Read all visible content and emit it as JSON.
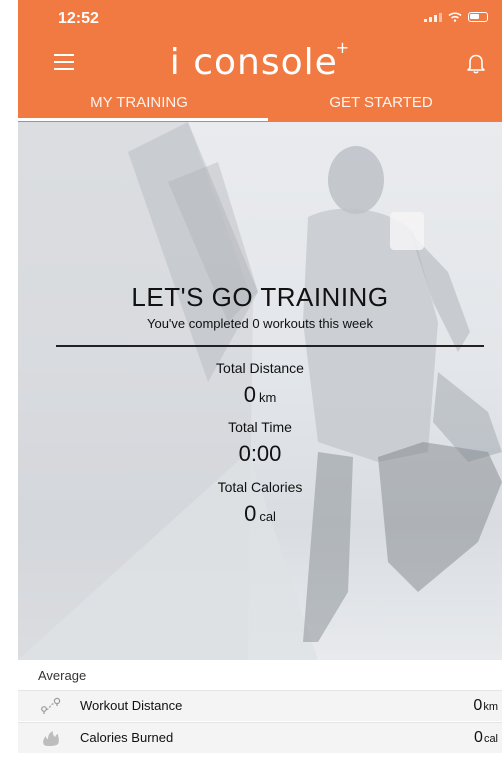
{
  "status_bar": {
    "time": "12:52"
  },
  "header": {
    "title": "i console",
    "title_sup": "+",
    "accent_color": "#f07a42",
    "icons": [
      "menu-icon",
      "bell-icon"
    ]
  },
  "tabs": [
    {
      "label": "MY TRAINING",
      "active": true
    },
    {
      "label": "GET STARTED",
      "active": false
    }
  ],
  "hero": {
    "headline": "LET'S GO TRAINING",
    "subline": "You've completed 0 workouts this week",
    "stats": [
      {
        "label": "Total Distance",
        "value": "0",
        "unit": "km"
      },
      {
        "label": "Total Time",
        "value": "0:00",
        "unit": ""
      },
      {
        "label": "Total Calories",
        "value": "0",
        "unit": "cal"
      }
    ]
  },
  "summary": {
    "title": "Average",
    "rows": [
      {
        "label": "Workout Distance",
        "value": "0",
        "unit": "km",
        "icon": "route-icon"
      },
      {
        "label": "Calories Burned",
        "value": "0",
        "unit": "cal",
        "icon": "flame-icon"
      }
    ]
  }
}
